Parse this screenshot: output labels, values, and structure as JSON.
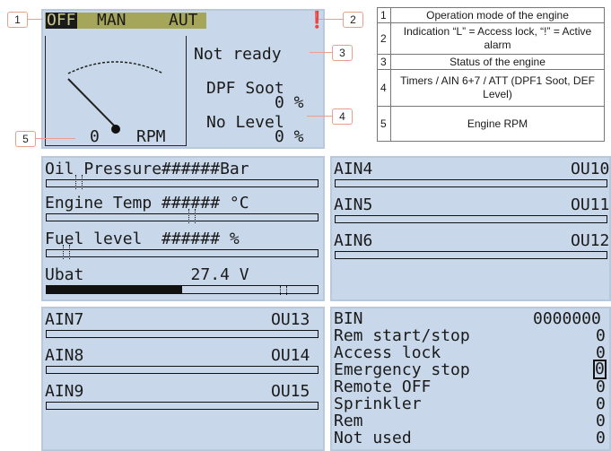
{
  "top_screen": {
    "modes": {
      "off": "OFF",
      "man": "MAN",
      "aut": "AUT"
    },
    "status": "Not ready",
    "timer1_label": "DPF Soot",
    "timer1_value": "0 %",
    "timer2_label": "No Level",
    "timer2_value": "0 %",
    "rpm_value": "0",
    "rpm_unit": "RPM",
    "alarm_icon": "alarm-exclamation-icon"
  },
  "callouts": {
    "c1": "1",
    "c2": "2",
    "c3": "3",
    "c4": "4",
    "c5": "5"
  },
  "legend": [
    {
      "num": "1",
      "desc": "Operation mode of the engine"
    },
    {
      "num": "2",
      "desc": "Indication “L” = Access lock, “!” = Active alarm"
    },
    {
      "num": "3",
      "desc": "Status of the engine"
    },
    {
      "num": "4",
      "desc": "Timers / AIN 6+7 / ATT (DPF1 Soot, DEF Level)"
    },
    {
      "num": "5",
      "desc": "Engine RPM"
    }
  ],
  "screen2": {
    "rows": [
      {
        "label": "Oil Pressure######Bar",
        "bar": 0.0
      },
      {
        "label": "Engine Temp ###### °C",
        "bar": 0.0
      },
      {
        "label": "Fuel level  ###### %",
        "bar": 0.0
      },
      {
        "label": "Ubat           27.4 V",
        "bar": 0.5
      }
    ]
  },
  "screen3": {
    "rows": [
      {
        "name": "AIN4",
        "code": "OU10"
      },
      {
        "name": "AIN5",
        "code": "OU11"
      },
      {
        "name": "AIN6",
        "code": "OU12"
      }
    ]
  },
  "screen4": {
    "rows": [
      {
        "name": "AIN7",
        "code": "OU13"
      },
      {
        "name": "AIN8",
        "code": "OU14"
      },
      {
        "name": "AIN9",
        "code": "OU15"
      }
    ]
  },
  "screen5": {
    "title": "BIN",
    "value": "0000000",
    "rows": [
      {
        "name": "Rem start/stop",
        "value": "0"
      },
      {
        "name": "Access lock",
        "value": "0"
      },
      {
        "name": "Emergency stop",
        "value": "0"
      },
      {
        "name": "Remote OFF",
        "value": "0"
      },
      {
        "name": "Sprinkler",
        "value": "0"
      },
      {
        "name": "Rem",
        "value": "0"
      },
      {
        "name": "Not used",
        "value": "0"
      }
    ]
  },
  "colors": {
    "lcd_bg": "#c8d8ea",
    "lcd_border": "#b9c9dc",
    "callout": "#e8a08c",
    "mode_highlight": "#a6a65a"
  }
}
